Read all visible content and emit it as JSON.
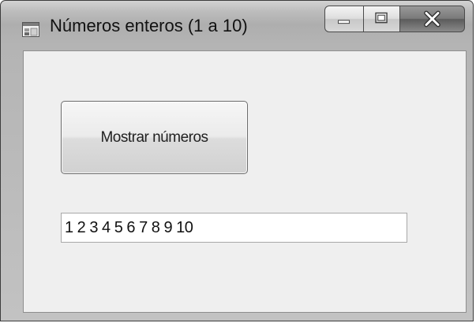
{
  "window": {
    "title": "Números enteros (1 a 10)"
  },
  "caption_buttons": {
    "minimize_icon": "minimize-icon",
    "maximize_icon": "maximize-icon",
    "close_icon": "close-icon"
  },
  "form": {
    "button_label": "Mostrar números",
    "output_value": "1 2 3 4 5 6 7 8 9 10"
  },
  "colors": {
    "client_background": "#efefef",
    "frame_gray": "#b4b4b4"
  }
}
